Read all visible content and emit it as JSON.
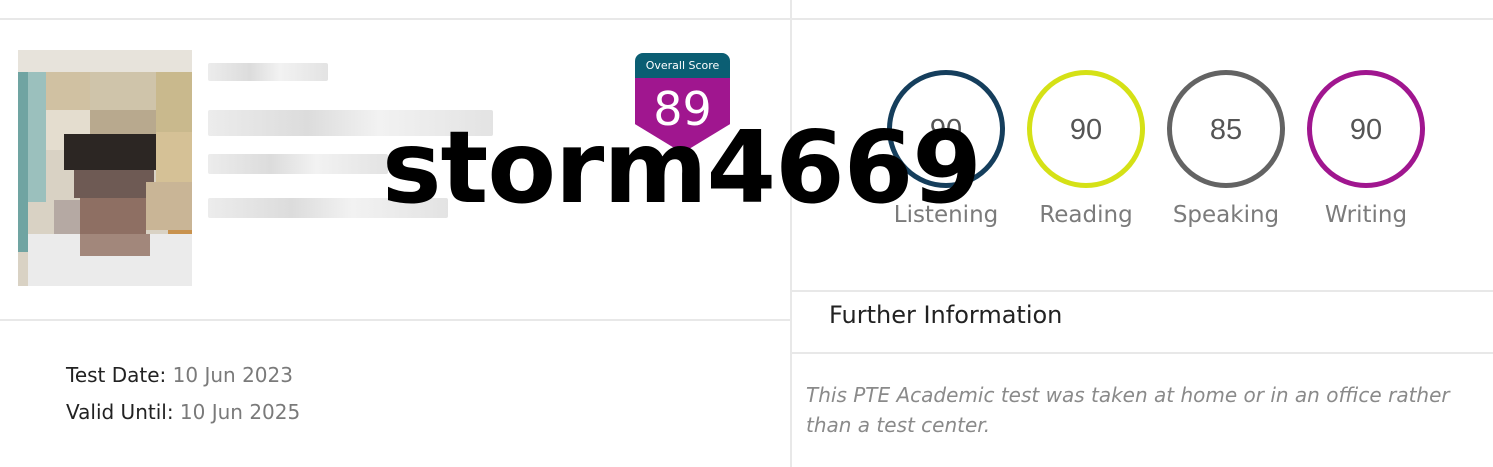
{
  "overall": {
    "label": "Overall Score",
    "value": "89",
    "colors": {
      "header": "#0b5e73",
      "badge": "#a0168f"
    }
  },
  "skills": [
    {
      "name": "Listening",
      "score": "90",
      "color": "#153e5c"
    },
    {
      "name": "Reading",
      "score": "90",
      "color": "#d5e116"
    },
    {
      "name": "Speaking",
      "score": "85",
      "color": "#636363"
    },
    {
      "name": "Writing",
      "score": "90",
      "color": "#a0168f"
    }
  ],
  "further_info": {
    "title": "Further Information",
    "text": "This PTE Academic test was taken at home or in an office rather than a test center."
  },
  "dates": {
    "test_date_label": "Test Date:",
    "test_date_value": " 10 Jun 2023",
    "valid_until_label": "Valid Until:",
    "valid_until_value": " 10 Jun 2025"
  },
  "watermark": {
    "text": "storm4669"
  }
}
